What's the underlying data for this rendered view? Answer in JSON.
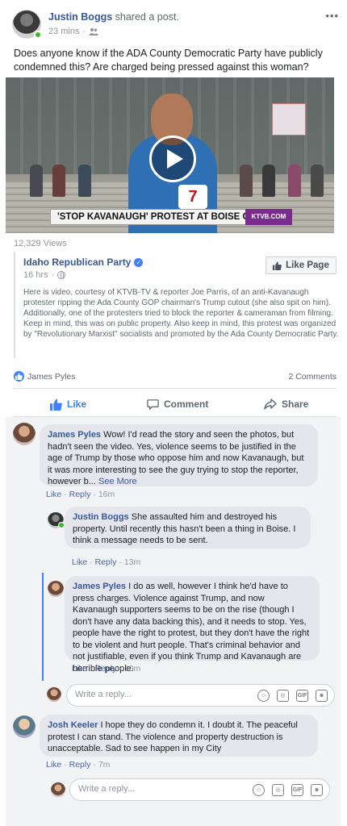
{
  "post": {
    "author": "Justin Boggs",
    "action_text": "shared a post.",
    "time": "23 mins",
    "audience_icon": "friends-icon",
    "more_icon": "more-icon",
    "text": "Does anyone know if the ADA County Democratic Party have publicly condemned this? Are charged being pressed against this woman?"
  },
  "video": {
    "lower_third": "'STOP KAVANAUGH' PROTEST AT BOISE CITY HALL",
    "logo_text": "KTVB.COM",
    "channel_number": "7",
    "views": "12,329 Views"
  },
  "shared": {
    "page_name": "Idaho Republican Party",
    "time": "16 hrs",
    "like_page_label": "Like Page",
    "text": "Here is video, courtesy of KTVB-TV & reporter Joe Parris, of an anti-Kavanaugh protester ripping the Ada County GOP chairman's Trump cutout (she also spit on him). Additionally, one of the protesters tried to block the reporter & cameraman from filming. Keep in mind, this was on public property. Also keep in mind, this protest was organized by \"Revolutionary Marxist\" socialists and promoted by the Ada County Democratic Party."
  },
  "reactions": {
    "names": "James Pyles",
    "comments_count": "2 Comments"
  },
  "actions": {
    "like": "Like",
    "comment": "Comment",
    "share": "Share"
  },
  "comments": [
    {
      "name": "James Pyles",
      "text": "Wow! I'd read the story and seen the photos, but hadn't seen the video. Yes, violence seems to be justified in the age of Trump by those who oppose him and now Kavanaugh, but it was more interesting to see the guy trying to stop the reporter, however b...",
      "see_more": "See More",
      "like": "Like",
      "reply": "Reply",
      "time": "16m"
    },
    {
      "name": "Justin Boggs",
      "text": "She assaulted him and destroyed his property. Until recently this hasn't been a thing in Boise. I think a message needs to be sent.",
      "like": "Like",
      "reply": "Reply",
      "time": "13m"
    },
    {
      "name": "James Pyles",
      "text": "I do as well, however I think he'd have to press charges. Violence against Trump, and now Kavanaugh supporters seems to be on the rise (though I don't have any data backing this), and it needs to stop. Yes, people have the right to protest, but they don't have the right to be violent and hurt people. That's criminal behavior and not justifiable, even if you think Trump and Kavanaugh are horrible people.",
      "like": "Like",
      "reply": "Reply",
      "time": "10m"
    },
    {
      "name": "Josh Keeler",
      "text": "I hope they do condemn it. I doubt it. The peaceful protest I can stand. The violence and property destruction is unacceptable. Sad to see happen in my City",
      "like": "Like",
      "reply": "Reply",
      "time": "7m"
    }
  ],
  "reply_placeholder": "Write a reply...",
  "reply_icons": [
    "emoji-icon",
    "camera-icon",
    "gif-icon",
    "sticker-icon"
  ],
  "colors": {
    "link_blue": "#385898",
    "like_blue": "#4080ff",
    "thread_line": "#4080ff",
    "comments_bg": "#f2f3f5",
    "online_green": "#42b72a"
  }
}
